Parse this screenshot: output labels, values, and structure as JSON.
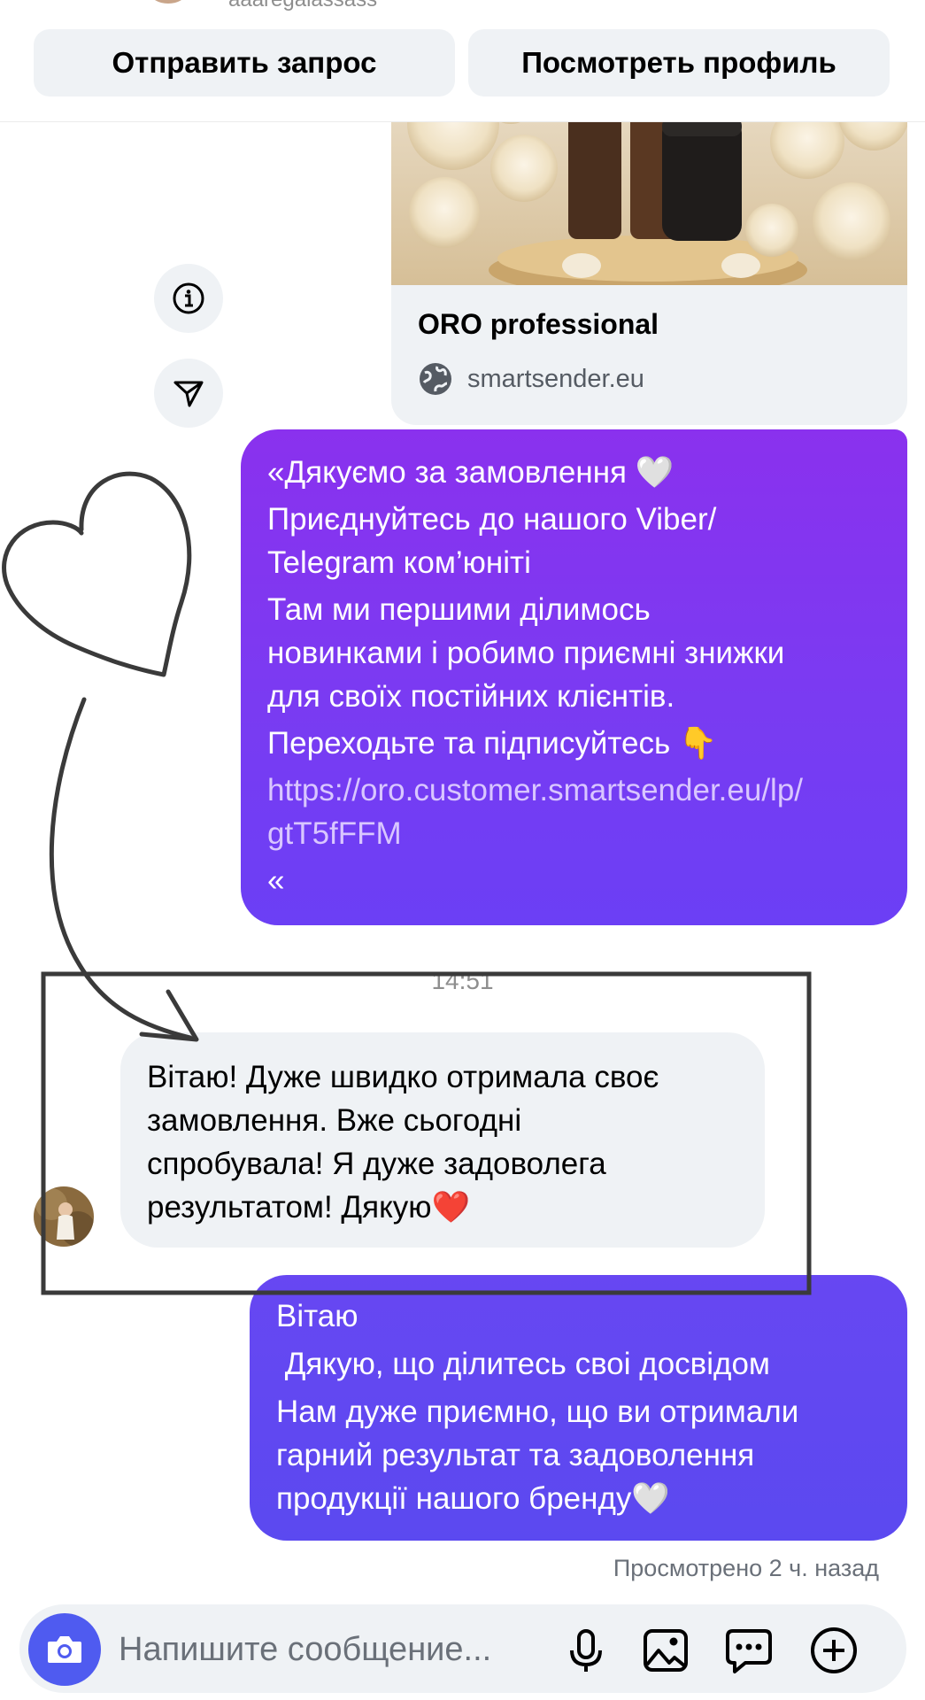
{
  "header": {
    "username": "aaaregalassass",
    "send_request_label": "Отправить запрос",
    "view_profile_label": "Посмотреть профиль"
  },
  "link_preview": {
    "title": "ORO professional",
    "site": "smartsender.eu"
  },
  "messages": {
    "outgoing_1": {
      "lines": [
        "«Дякуємо за замовлення 🤍",
        "Приєднуйтесь до нашого Viber/",
        "Telegram ком’юніті",
        "Там ми першими ділимось",
        "новинками і робимо приємні знижки",
        "для своїх постійних клієнтів.",
        "Переходьте та підписуйтесь 👇",
        "https://oro.customer.smartsender.eu/lp/",
        "gtT5fFFM",
        "«"
      ]
    },
    "timestamp": "14:51",
    "incoming_1": {
      "lines": [
        "Вітаю! Дуже швидко отримала своє",
        "замовлення. Вже сьогодні",
        "спробувала! Я дуже задоволега",
        "результатом! Дякую❤️"
      ]
    },
    "outgoing_2": {
      "lines": [
        "Вітаю",
        " Дякую, що ділитесь своі досвідом",
        "Нам дуже приємно, що ви отримали",
        "гарний результат та задоволення",
        "продукції нашого бренду🤍"
      ]
    },
    "seen_status": "Просмотрено 2 ч. назад"
  },
  "composer": {
    "placeholder": "Напишите сообщение..."
  },
  "icons": {
    "info": "info-icon",
    "share": "paper-plane-icon",
    "globe": "globe-icon",
    "camera": "camera-icon",
    "mic": "microphone-icon",
    "gallery": "image-icon",
    "sticker": "chat-bubble-icon",
    "add": "plus-circle-icon"
  },
  "colors": {
    "accent": "#4f5bf0",
    "bubble_out_1_top": "#8a31ee",
    "bubble_out_2": "#5b49f0",
    "bubble_in": "#eff2f5"
  }
}
